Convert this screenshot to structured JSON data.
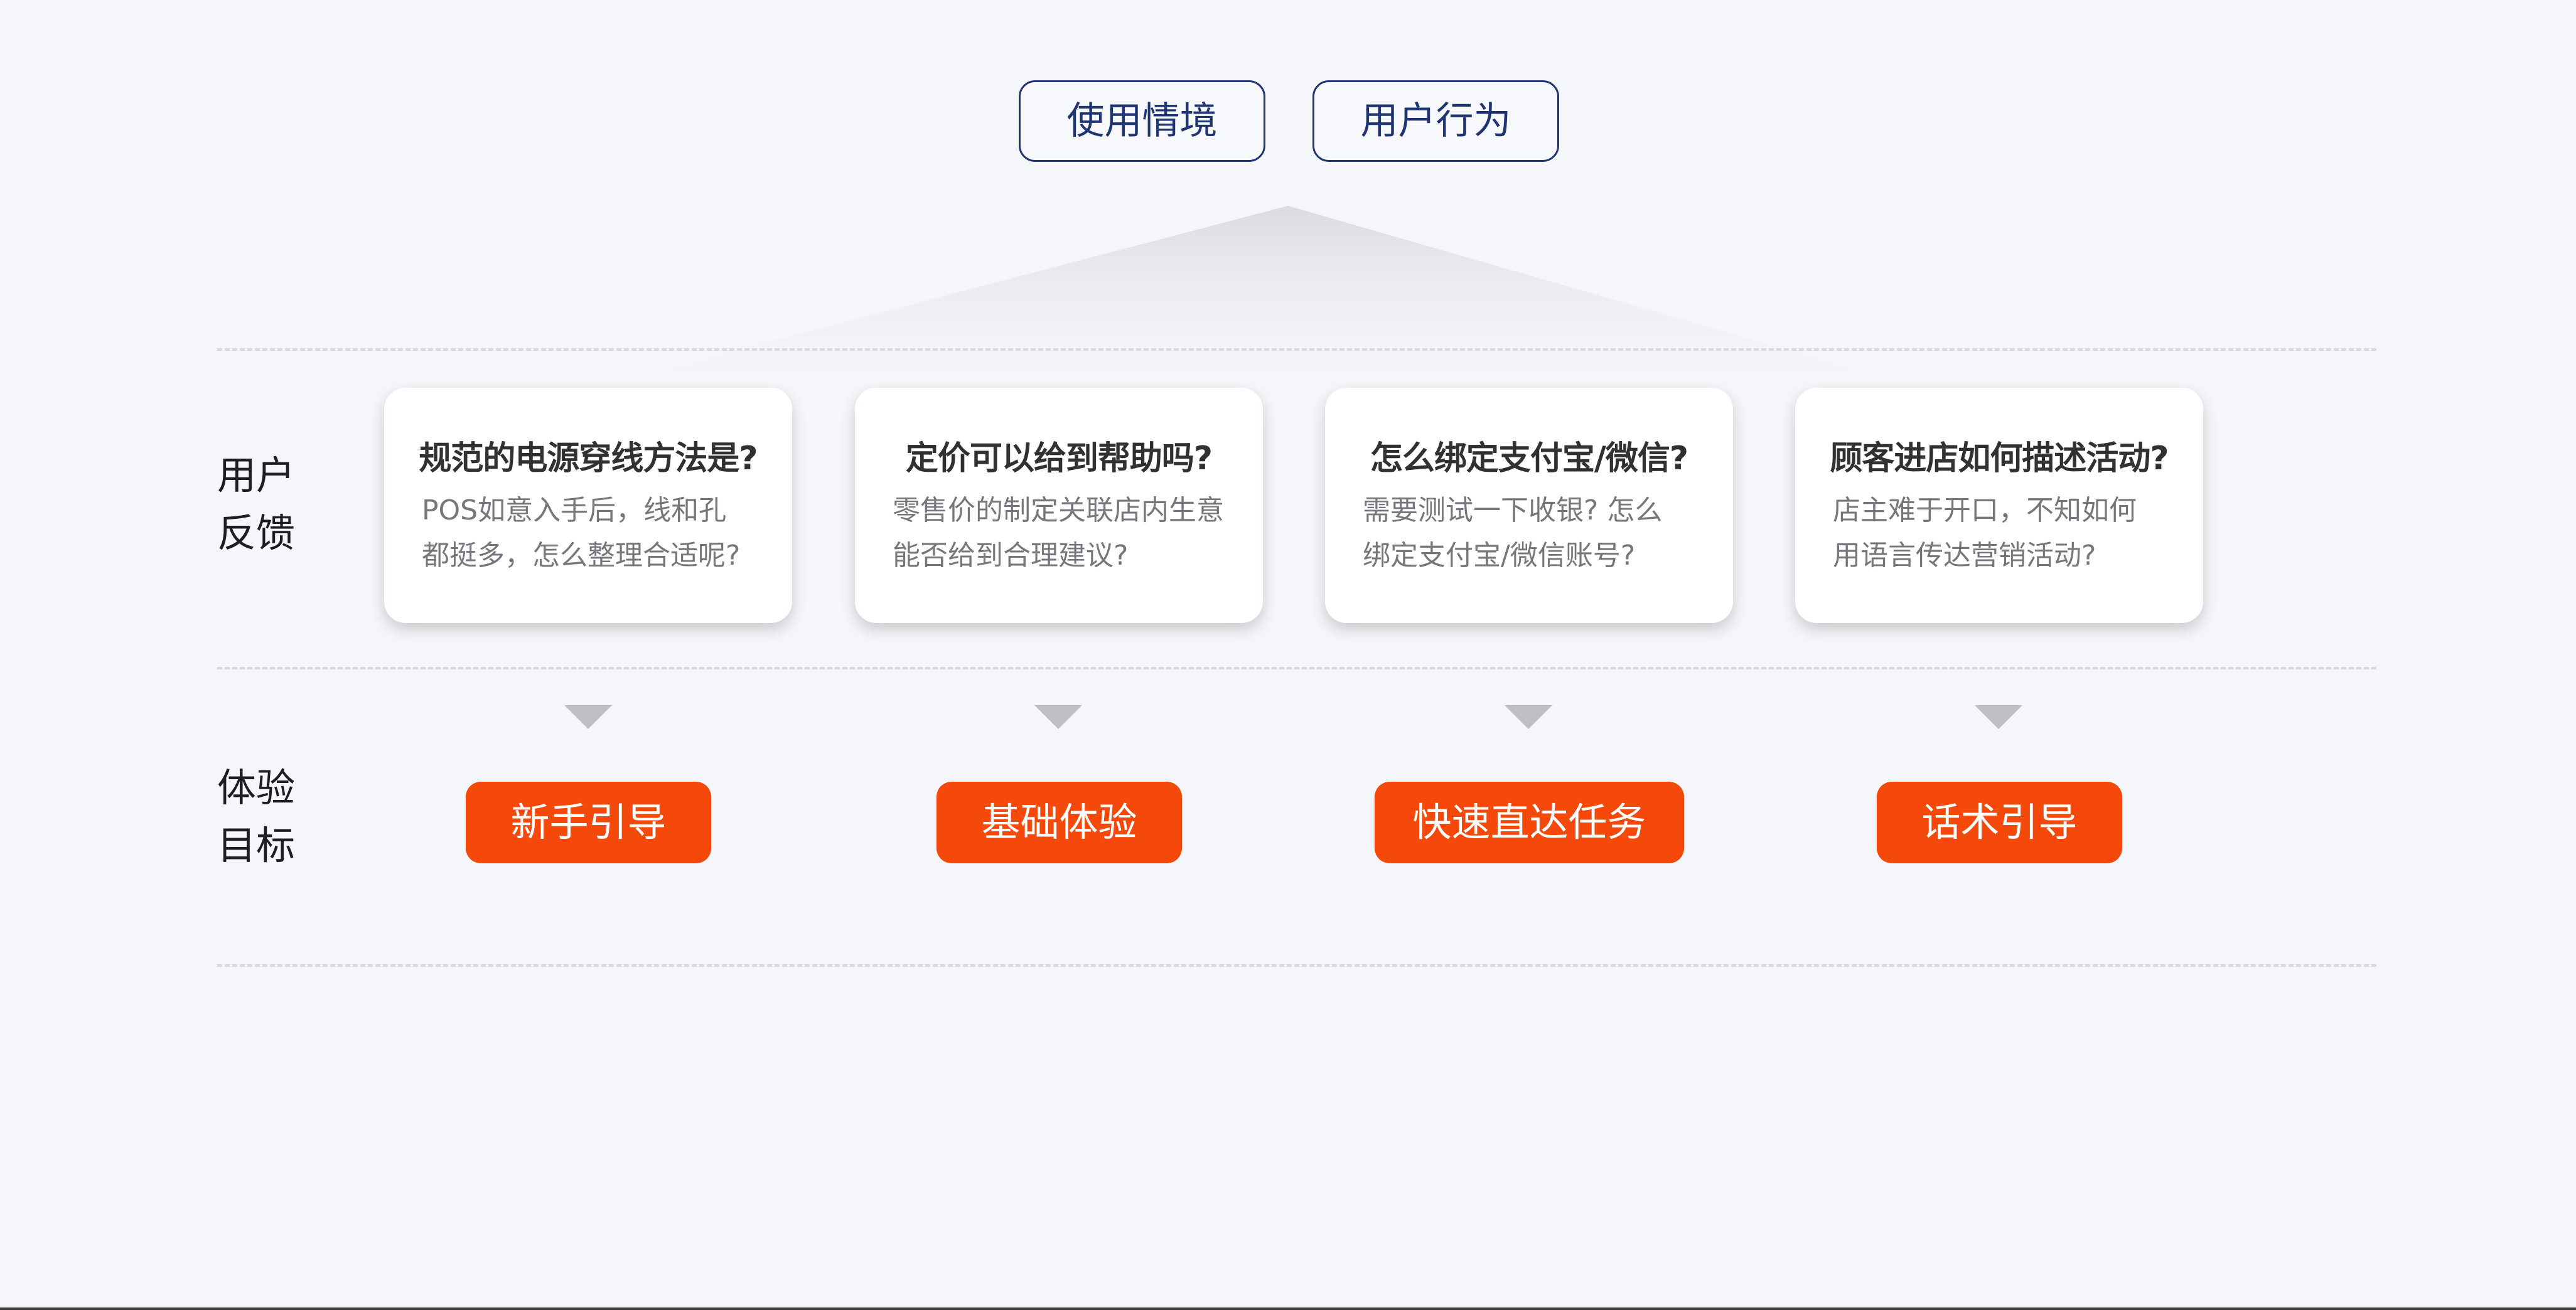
{
  "top_tags": {
    "context": "使用情境",
    "behavior": "用户行为"
  },
  "rows": {
    "feedback_label_line1": "用户",
    "feedback_label_line2": "反馈",
    "goal_label_line1": "体验",
    "goal_label_line2": "目标"
  },
  "cards": [
    {
      "title": "规范的电源穿线方法是?",
      "desc_line1": "POS如意入手后，线和孔",
      "desc_line2": "都挺多，怎么整理合适呢?"
    },
    {
      "title": "定价可以给到帮助吗?",
      "desc_line1": "零售价的制定关联店内生意",
      "desc_line2": "能否给到合理建议?"
    },
    {
      "title": "怎么绑定支付宝/微信?",
      "desc_line1": "需要测试一下收银? 怎么",
      "desc_line2": "绑定支付宝/微信账号?"
    },
    {
      "title": "顾客进店如何描述活动?",
      "desc_line1": "店主难于开口，不知如何",
      "desc_line2": "用语言传达营销活动?"
    }
  ],
  "goals": [
    "新手引导",
    "基础体验",
    "快速直达任务",
    "话术引导"
  ],
  "colors": {
    "background": "#f4f6f9",
    "tag_border": "#1f3472",
    "goal_button": "#f4490b",
    "card_title": "#313133",
    "card_desc": "#75777d",
    "arrow": "#bdbfc2"
  },
  "icons": {
    "arrow": "triangle-down-icon"
  }
}
